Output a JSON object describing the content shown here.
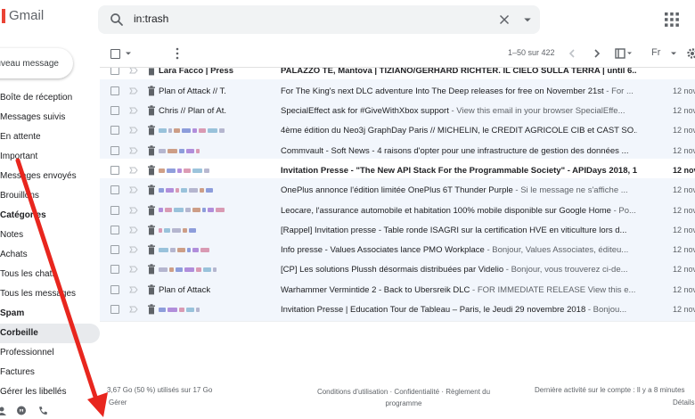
{
  "app": {
    "logo_text": "Gmail",
    "brand_color": "#ea4335"
  },
  "search": {
    "value": "in:trash"
  },
  "sidebar": {
    "compose_label": "Nouveau message",
    "items": [
      {
        "label": "Boîte de réception",
        "style": "normal"
      },
      {
        "label": "Messages suivis",
        "style": "normal"
      },
      {
        "label": "En attente",
        "style": "normal"
      },
      {
        "label": "Important",
        "style": "normal"
      },
      {
        "label": "Messages envoyés",
        "style": "normal"
      },
      {
        "label": "Brouillons",
        "style": "normal"
      },
      {
        "label": "Catégories",
        "style": "bold"
      },
      {
        "label": "Notes",
        "style": "normal"
      },
      {
        "label": "Achats",
        "style": "normal"
      },
      {
        "label": "Tous les chats",
        "style": "normal"
      },
      {
        "label": "Tous les messages",
        "style": "normal"
      },
      {
        "label": "Spam",
        "style": "bold"
      },
      {
        "label": "Corbeille",
        "style": "active"
      },
      {
        "label": "Professionnel",
        "style": "normal"
      },
      {
        "label": "Factures",
        "style": "normal"
      },
      {
        "label": "Gérer les libellés",
        "style": "normal"
      }
    ]
  },
  "toolbar": {
    "pager": "1–50 sur 422",
    "language": "Fr"
  },
  "emails": [
    {
      "sender": "Lara Facco | Press",
      "subject": "PALAZZO TE, Mantova | TIZIANO/GERHARD RICHTER. IL CIELO SULLA TERRA | until 6...",
      "snippet": "",
      "date": "",
      "unread": true,
      "blurred": false
    },
    {
      "sender": "Plan of Attack // T.",
      "subject": "For The King's next DLC adventure Into The Deep releases for free on November 21st",
      "snippet": " - For ...",
      "date": "12 nov",
      "unread": false,
      "blurred": false
    },
    {
      "sender": "Chris // Plan of At.",
      "subject": "SpecialEffect ask for #GiveWithXbox support",
      "snippet": " - View this email in your browser SpecialEffe...",
      "date": "12 nov",
      "unread": false,
      "blurred": false
    },
    {
      "sender": "",
      "subject": "4ème édition du Neo3j GraphDay Paris // MICHELIN, le CREDIT AGRICOLE CIB et CAST SO...",
      "snippet": "",
      "date": "12 nov",
      "unread": false,
      "blurred": true
    },
    {
      "sender": "",
      "subject": "Commvault - Soft News - 4 raisons d'opter pour une infrastructure de gestion des données ...",
      "snippet": "",
      "date": "12 nov",
      "unread": false,
      "blurred": true
    },
    {
      "sender": "",
      "subject": "Invitation Presse - \"The New API Stack For the Programmable Society\" - APIDays 2018, 1...",
      "snippet": "",
      "date": "12 nov",
      "unread": true,
      "blurred": true
    },
    {
      "sender": "",
      "subject": "OnePlus annonce l'édition limitée OnePlus 6T Thunder Purple",
      "snippet": " - Si le message ne s'affiche ...",
      "date": "12 nov",
      "unread": false,
      "blurred": true
    },
    {
      "sender": "",
      "subject": "Leocare, l'assurance automobile et habitation 100% mobile disponible sur Google Home",
      "snippet": " - Po...",
      "date": "12 nov",
      "unread": false,
      "blurred": true
    },
    {
      "sender": "",
      "subject": "[Rappel] Invitation presse - Table ronde ISAGRI sur la certification HVE en viticulture lors d...",
      "snippet": "",
      "date": "12 nov",
      "unread": false,
      "blurred": true
    },
    {
      "sender": "",
      "subject": "Info presse - Values Associates lance PMO Workplace",
      "snippet": " - Bonjour, Values Associates, éditeu...",
      "date": "12 nov",
      "unread": false,
      "blurred": true
    },
    {
      "sender": "",
      "subject": "[CP] Les solutions Plussh désormais distribuées par Videlio",
      "snippet": " - Bonjour, vous trouverez ci-de...",
      "date": "12 nov",
      "unread": false,
      "blurred": true
    },
    {
      "sender": "Plan of Attack",
      "subject": "Warhammer Vermintide 2 - Back to Ubersreik DLC",
      "snippet": " - FOR IMMEDIATE RELEASE View this e...",
      "date": "12 nov",
      "unread": false,
      "blurred": false
    },
    {
      "sender": "",
      "subject": "Invitation Presse | Education Tour de Tableau – Paris, le Jeudi 29 novembre 2018",
      "snippet": " - Bonjou...",
      "date": "12 nov",
      "unread": false,
      "blurred": true
    }
  ],
  "footer": {
    "storage": "3,67 Go (50 %) utilisés sur 17 Go",
    "manage": "Gérer",
    "links_line1": "Conditions d'utilisation · Confidentialité · Règlement du",
    "links_line2": "programme",
    "activity": "Dernière activité sur le compte : Il y a 8 minutes",
    "details": "Détails"
  },
  "annotation": {
    "arrow_color": "#e8261e"
  }
}
